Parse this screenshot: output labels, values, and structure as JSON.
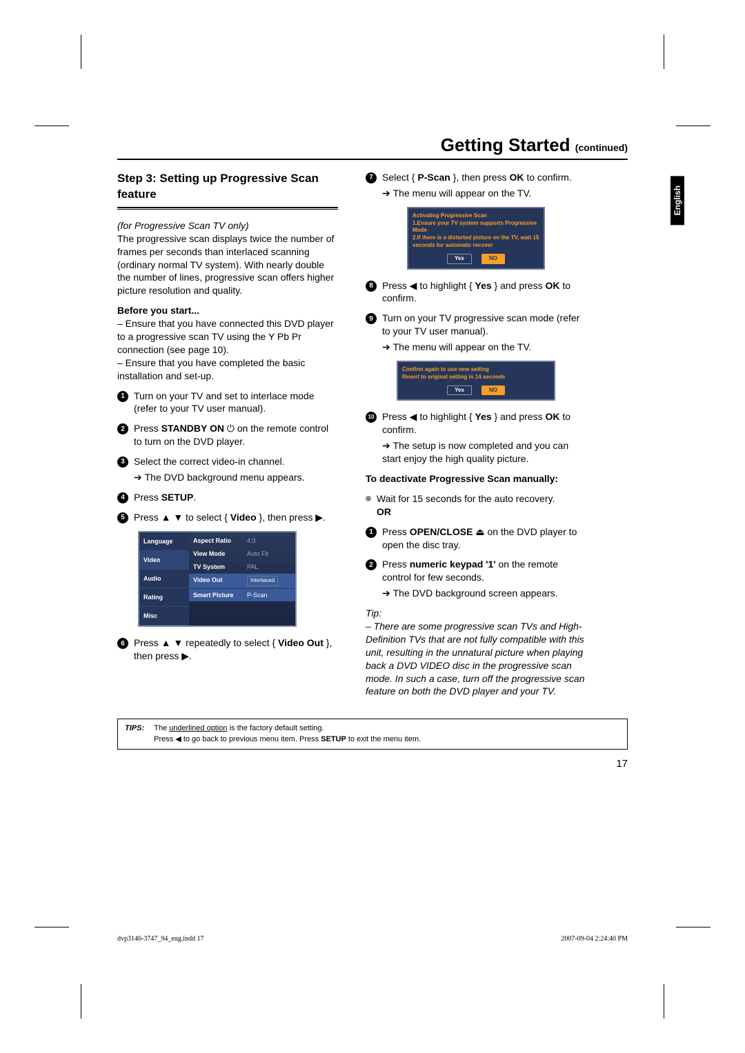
{
  "header": {
    "title": "Getting Started",
    "continued": "(continued)"
  },
  "langtab": "English",
  "left": {
    "step_heading": "Step 3:  Setting up Progressive Scan feature",
    "subtitle_italic": "(for Progressive Scan TV only)",
    "intro": "The progressive scan displays twice the number of frames per seconds than interlaced scanning (ordinary normal TV system). With nearly double the number of lines, progressive scan offers higher picture resolution and quality.",
    "before_heading": "Before you start...",
    "before_p1": "– Ensure that you have connected this DVD player to a progressive scan TV using the Y Pb Pr connection (see page 10).",
    "before_p2": "– Ensure that you have completed the basic installation and set-up.",
    "s1": "Turn on your TV and set to interlace mode (refer to your TV user manual).",
    "s2_a": "Press ",
    "s2_b": "STANDBY ON",
    "s2_c": " ⏻ on the remote control to turn on the DVD player.",
    "s3": "Select the correct video-in channel.",
    "s3_sub": "The DVD background menu appears.",
    "s4_a": "Press ",
    "s4_b": "SETUP",
    "s4_c": ".",
    "s5_a": "Press ▲ ▼ to select { ",
    "s5_b": "Video",
    "s5_c": " }, then press ▶.",
    "s6_a": "Press ▲ ▼ repeatedly to select { ",
    "s6_b": "Video Out",
    "s6_c": " }, then press ▶."
  },
  "osd": {
    "tabs": [
      "Language",
      "Video",
      "Audio",
      "Rating",
      "Misc"
    ],
    "items": [
      {
        "k": "Aspect Ratio",
        "v": "4:3"
      },
      {
        "k": "View Mode",
        "v": "Auto Fit"
      },
      {
        "k": "TV System",
        "v": "PAL"
      },
      {
        "k": "Video Out",
        "v": "Interlaced"
      },
      {
        "k": "Smart Picture",
        "v": "P-Scan"
      }
    ]
  },
  "right": {
    "s7_a": "Select { ",
    "s7_b": "P-Scan",
    "s7_c": " }, then press ",
    "s7_d": "OK",
    "s7_e": " to confirm.",
    "s7_sub": "The menu will appear on the TV.",
    "dlg1_l1": "Activating Progressive Scan",
    "dlg1_l2": "1.Ensure your TV system supports Progressive Mode",
    "dlg1_l3": "2.If there is a distorted picture on the TV, wait 15 seconds for automatic recover",
    "btn_yes": "Yes",
    "btn_no": "NO",
    "s8_a": "Press ◀ to highlight { ",
    "s8_b": "Yes",
    "s8_c": " } and press ",
    "s8_d": "OK",
    "s8_e": " to confirm.",
    "s9": "Turn on your TV progressive scan mode (refer to your TV user manual).",
    "s9_sub": "The menu will appear on the TV.",
    "dlg2_l1": "Confirm again to use new setting",
    "dlg2_l2": "Revert to original setting in 14 seconds",
    "s10_a": "Press ◀ to highlight { ",
    "s10_b": "Yes",
    "s10_c": " } and press ",
    "s10_d": "OK",
    "s10_e": " to confirm.",
    "s10_sub": "The setup is now completed and you can start enjoy the high quality picture.",
    "deact_h": "To deactivate Progressive Scan manually:",
    "b1": "Wait for 15 seconds for the auto recovery.",
    "or": "OR",
    "d1_a": "Press ",
    "d1_b": "OPEN/CLOSE",
    "d1_c": " ⏏ on the DVD player to open the disc tray.",
    "d2_a": "Press ",
    "d2_b": "numeric keypad '1'",
    "d2_c": " on the remote control for few seconds.",
    "d2_sub": "The DVD background screen appears.",
    "tip_label": "Tip:",
    "tip": "– There are some progressive scan TVs and High-Definition TVs that are not fully compatible with this unit, resulting in the unnatural picture when playing back a DVD VIDEO disc in the progressive scan mode. In such a case, turn off the progressive scan feature on both the DVD player and your TV."
  },
  "tips_box": {
    "label": "TIPS:",
    "l1_a": "The ",
    "l1_u": "underlined option",
    "l1_b": " is the factory default setting.",
    "l2_a": "Press ◀ to go back to previous menu item. Press ",
    "l2_b": "SETUP",
    "l2_c": " to exit the menu item."
  },
  "pagenum": "17",
  "footer": {
    "left": "dvp3146-3747_94_eng.indd   17",
    "right": "2007-09-04   2:24:40 PM"
  }
}
